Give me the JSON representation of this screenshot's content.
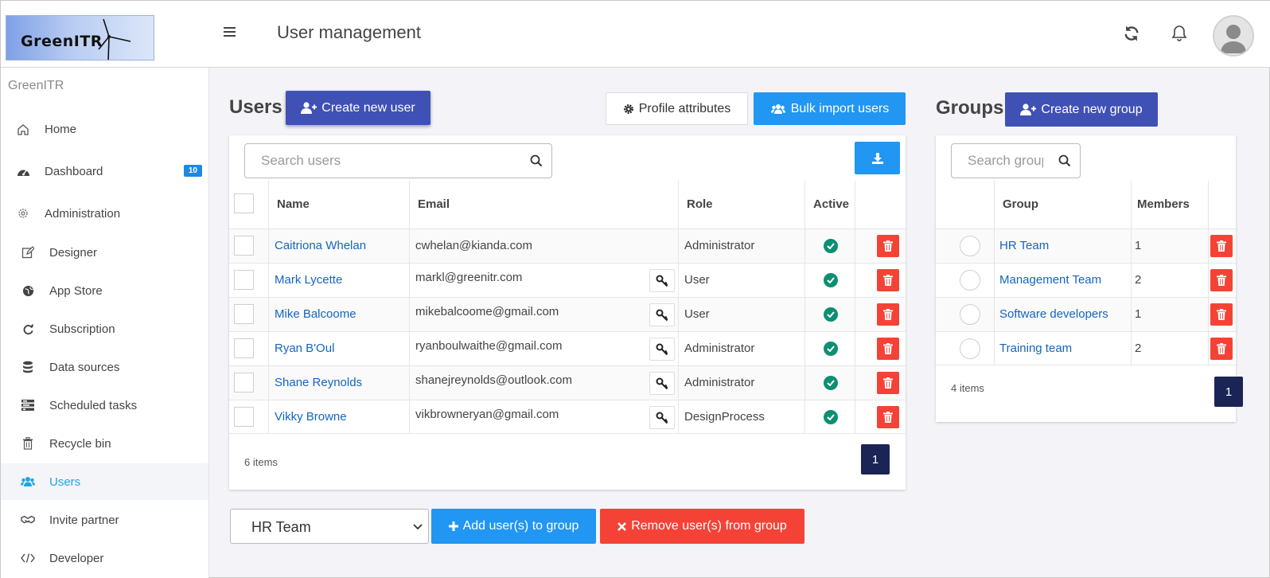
{
  "header": {
    "logo_text": "GreenITR",
    "title": "User management",
    "icons": [
      "refresh-icon",
      "bell-icon"
    ]
  },
  "sidebar": {
    "brand": "GreenITR",
    "items": [
      {
        "label": "Home",
        "icon": "home-icon"
      },
      {
        "label": "Dashboard",
        "icon": "dashboard-icon",
        "badge": "10"
      },
      {
        "label": "Administration",
        "icon": "gear-icon"
      },
      {
        "label": "Designer",
        "icon": "edit-icon"
      },
      {
        "label": "App Store",
        "icon": "globe-icon"
      },
      {
        "label": "Subscription",
        "icon": "refresh-icon"
      },
      {
        "label": "Data sources",
        "icon": "database-icon"
      },
      {
        "label": "Scheduled tasks",
        "icon": "tasks-icon"
      },
      {
        "label": "Recycle bin",
        "icon": "trash-icon"
      },
      {
        "label": "Users",
        "icon": "users-icon",
        "active": true
      },
      {
        "label": "Invite partner",
        "icon": "handshake-icon"
      },
      {
        "label": "Developer",
        "icon": "code-icon"
      }
    ]
  },
  "users": {
    "title": "Users",
    "create_label": "Create new user",
    "profile_label": "Profile attributes",
    "bulk_label": "Bulk import users",
    "search_placeholder": "Search users",
    "columns": {
      "name": "Name",
      "email": "Email",
      "role": "Role",
      "active": "Active"
    },
    "rows": [
      {
        "name": "Caitriona Whelan",
        "email": "cwhelan@kianda.com",
        "role": "Administrator",
        "active": true,
        "key": false
      },
      {
        "name": "Mark Lycette",
        "email": "markl@greenitr.com",
        "role": "User",
        "active": true,
        "key": true
      },
      {
        "name": "Mike Balcoome",
        "email": "mikebalcoome@gmail.com",
        "role": "User",
        "active": true,
        "key": true
      },
      {
        "name": "Ryan B'Oul",
        "email": "ryanboulwaithe@gmail.com",
        "role": "Administrator",
        "active": true,
        "key": true
      },
      {
        "name": "Shane Reynolds",
        "email": "shanejreynolds@outlook.com",
        "role": "Administrator",
        "active": true,
        "key": true
      },
      {
        "name": "Vikky Browne",
        "email": "vikbrowneryan@gmail.com",
        "role": "DesignProcess",
        "active": true,
        "key": true
      }
    ],
    "count": "6 items",
    "page": "1"
  },
  "groups": {
    "title": "Groups",
    "create_label": "Create new group",
    "search_placeholder": "Search groups",
    "columns": {
      "group": "Group",
      "members": "Members"
    },
    "rows": [
      {
        "name": "HR Team",
        "members": "1"
      },
      {
        "name": "Management Team",
        "members": "2"
      },
      {
        "name": "Software developers",
        "members": "1"
      },
      {
        "name": "Training team",
        "members": "2"
      }
    ],
    "count": "4 items",
    "page": "1"
  },
  "footer": {
    "selected_group": "HR Team",
    "add_label": "Add user(s) to group",
    "remove_label": "Remove user(s) from group"
  },
  "colors": {
    "indigo": "#3f51b5",
    "blue": "#2196f3",
    "red": "#f44336",
    "check": "#0d8f72",
    "page": "#1a2556",
    "link": "#1565c0"
  }
}
